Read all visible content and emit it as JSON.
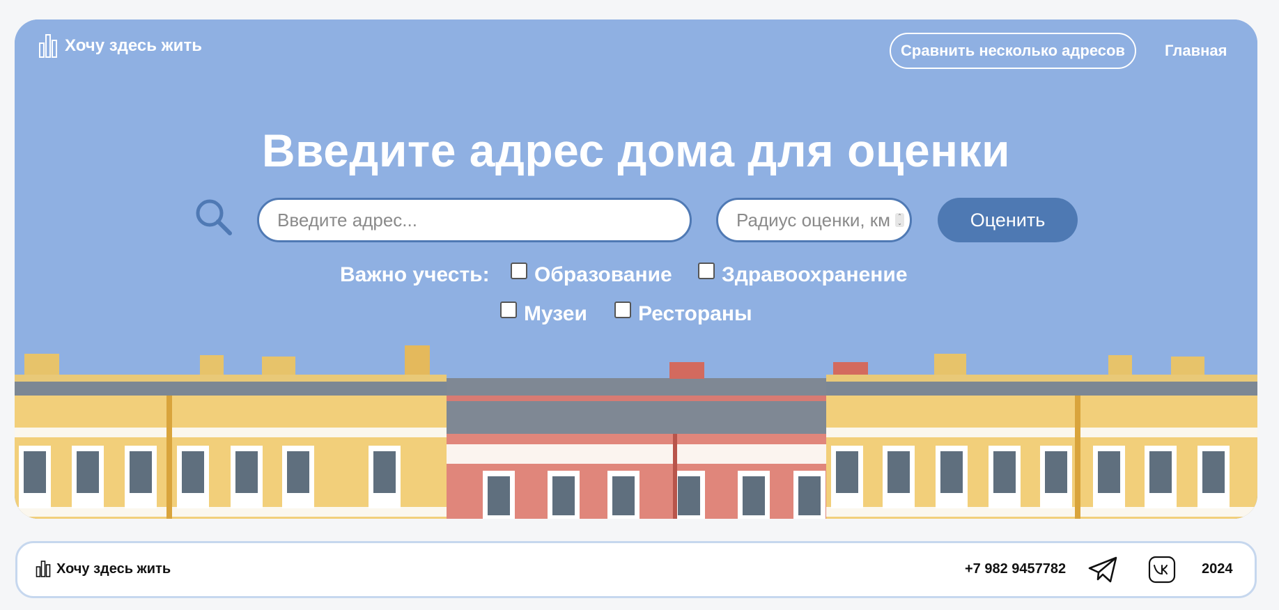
{
  "header": {
    "brand": "Хочу здесь жить",
    "compare_label": "Сравнить несколько адресов",
    "home_label": "Главная"
  },
  "hero": {
    "title": "Введите адрес дома для оценки",
    "address_placeholder": "Введите адрес...",
    "radius_placeholder": "Радиус оценки, км",
    "submit_label": "Оценить",
    "options_label": "Важно учесть:",
    "options": [
      {
        "label": "Образование",
        "checked": false
      },
      {
        "label": "Здравоохранение",
        "checked": false
      },
      {
        "label": "Музеи",
        "checked": false
      },
      {
        "label": "Рестораны",
        "checked": false
      }
    ]
  },
  "footer": {
    "brand": "Хочу здесь жить",
    "phone": "+7 982 9457782",
    "year": "2024"
  },
  "colors": {
    "sky": "#8fb0e2",
    "accent": "#4e79b3",
    "footer_border": "#c6d7ee"
  },
  "icons": [
    "bar-chart-logo-icon",
    "search-icon",
    "telegram-icon",
    "vk-icon"
  ]
}
